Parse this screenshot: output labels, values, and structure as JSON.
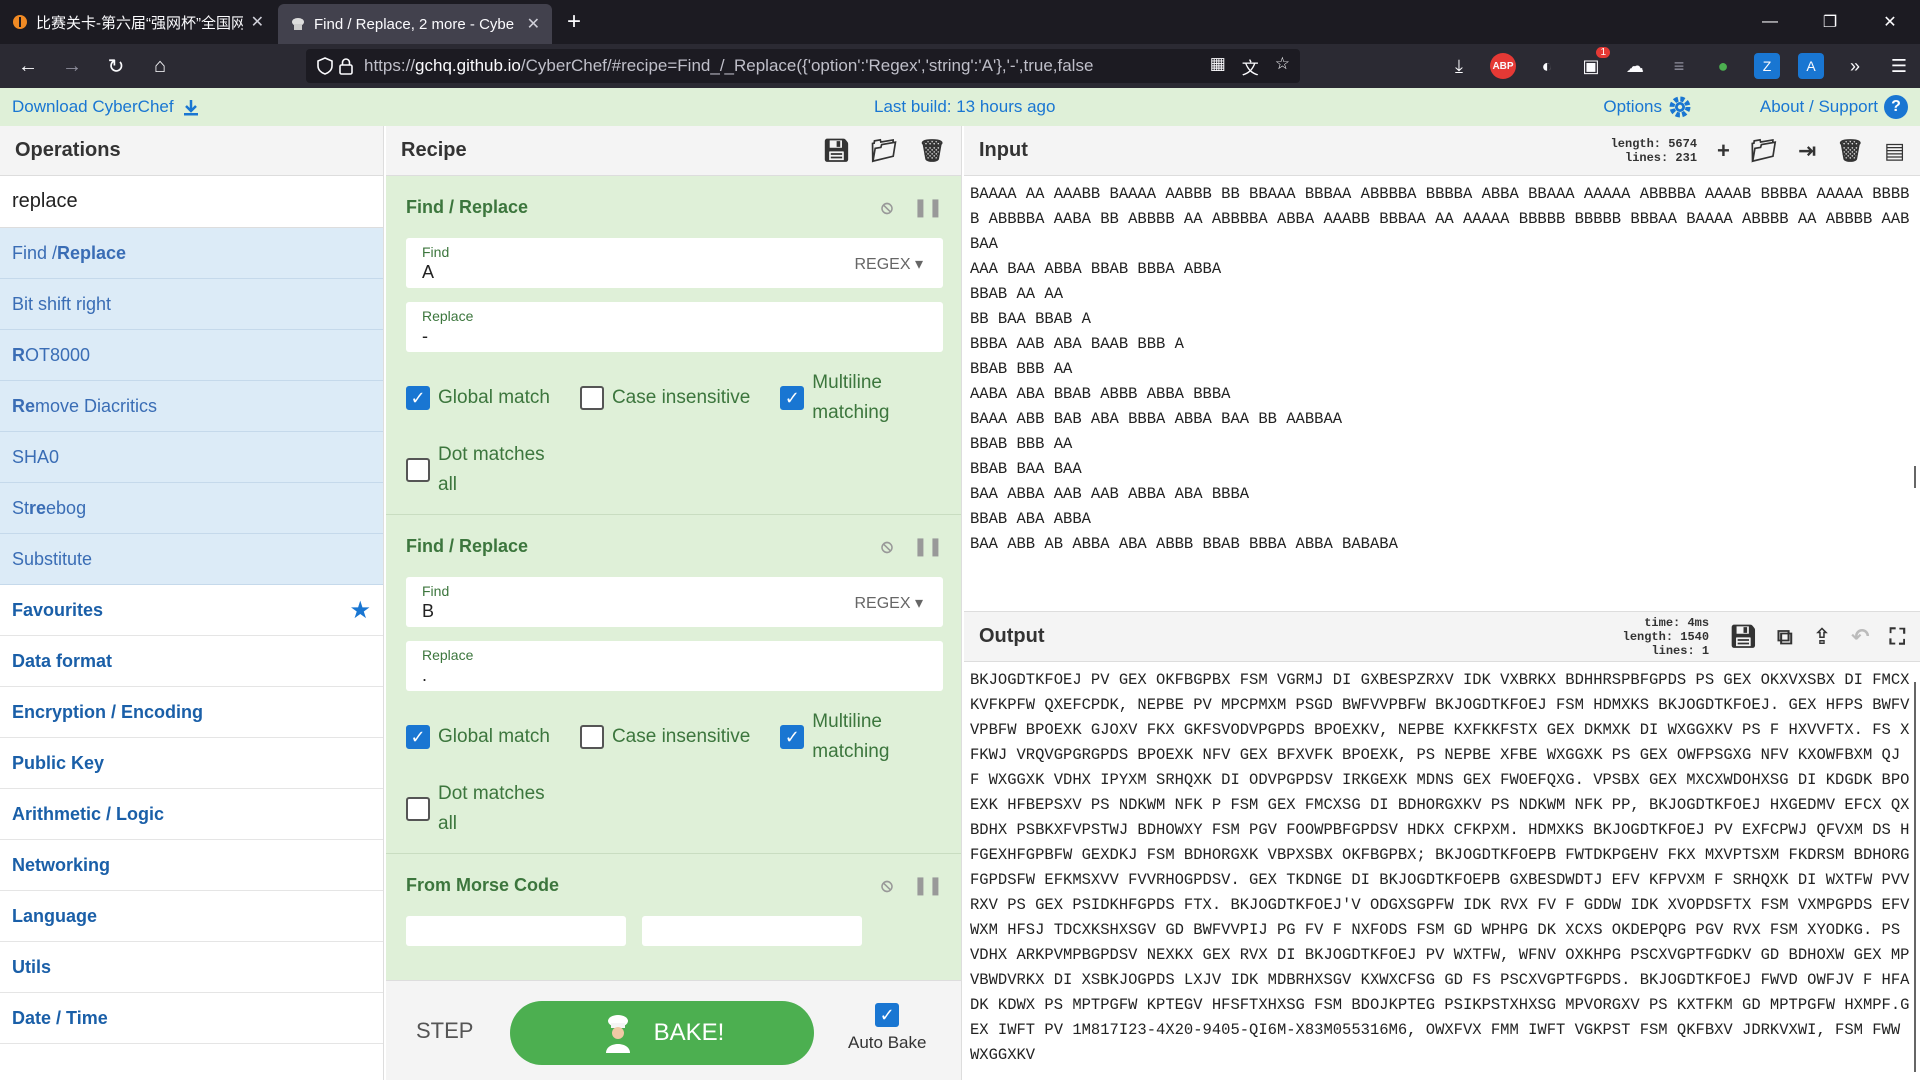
{
  "browser": {
    "tabs": [
      {
        "label": "比赛关卡-第六届“强网杯”全国网",
        "active": false
      },
      {
        "label": "Find / Replace, 2 more - Cybe",
        "active": true
      }
    ],
    "url_prefix": "https://",
    "url_host": "gchq.github.io",
    "url_path": "/CyberChef/#recipe=Find_/_Replace({'option':'Regex','string':'A'},'-',true,false",
    "extensions": [
      "download-icon",
      "adblock-icon",
      "extension-icon",
      "badge-extension-icon",
      "extension-icon-2",
      "extension-icon-3",
      "extension-icon-4",
      "zotero-icon",
      "translate-icon",
      "more-icon",
      "menu-icon"
    ],
    "ext_badge": "1",
    "abp_label": "ABP"
  },
  "banner": {
    "download": "Download CyberChef",
    "last_build": "Last build: 13 hours ago",
    "options": "Options",
    "about": "About / Support",
    "help": "?"
  },
  "operations": {
    "title": "Operations",
    "search": "replace",
    "results": [
      {
        "pre": "Find / ",
        "match": "Replace",
        "post": ""
      },
      {
        "pre": "Bit shift right",
        "match": "",
        "post": ""
      },
      {
        "pre": "",
        "match": "R",
        "post": "OT8000"
      },
      {
        "pre": "",
        "match": "Re",
        "post": "move Diacritics"
      },
      {
        "pre": "SHA0",
        "match": "",
        "post": ""
      },
      {
        "pre": "St",
        "match": "re",
        "post": "ebog"
      },
      {
        "pre": "Substitute",
        "match": "",
        "post": ""
      }
    ],
    "categories": [
      "Favourites",
      "Data format",
      "Encryption / Encoding",
      "Public Key",
      "Arithmetic / Logic",
      "Networking",
      "Language",
      "Utils",
      "Date / Time"
    ]
  },
  "recipe": {
    "title": "Recipe",
    "ops": [
      {
        "name": "Find / Replace",
        "find_label": "Find",
        "find": "A",
        "mode": "REGEX",
        "replace_label": "Replace",
        "replace": "-",
        "global": "Global match",
        "case": "Case insensitive",
        "multi1": "Multiline",
        "multi2": "matching",
        "dot1": "Dot matches",
        "dot2": "all"
      },
      {
        "name": "Find / Replace",
        "find_label": "Find",
        "find": "B",
        "mode": "REGEX",
        "replace_label": "Replace",
        "replace": ".",
        "global": "Global match",
        "case": "Case insensitive",
        "multi1": "Multiline",
        "multi2": "matching",
        "dot1": "Dot matches",
        "dot2": "all"
      },
      {
        "name": "From Morse Code"
      }
    ],
    "step": "STEP",
    "bake": "BAKE!",
    "auto_bake": "Auto Bake"
  },
  "input": {
    "title": "Input",
    "length_label": "length:",
    "length": "5674",
    "lines_label": "lines:",
    "lines": "231",
    "text": "BAAAA AA AAABB BAAAA AABBB BB BBAAA BBBAA ABBBBA BBBBA ABBA BBAAA AAAAA ABBBBA AAAAB BBBBA AAAAA BBBBB ABBBBA AABA BB ABBBB AA ABBBBA ABBA AAABB BBBAA AA AAAAA BBBBB BBBBB BBBAA BAAAA ABBBB AA ABBBB AABBAA\nAAA BAA ABBA BBAB BBBA ABBA\nBBAB AA AA\nBB BAA BBAB A\nBBBA AAB ABA BAAB BBB A\nBBAB BBB AA\nAABA ABA BBAB ABBB ABBA BBBA\nBAAA ABB BAB ABA BBBA ABBA BAA BB AABBAA\nBBAB BBB AA\nBBAB BAA BAA\nBAA ABBA AAB AAB ABBA ABA BBBA\nBBAB ABA ABBA\nBAA ABB AB ABBA ABA ABBB BBAB BBBA ABBA BABABA"
  },
  "output": {
    "title": "Output",
    "time_label": "time:",
    "time": "4ms",
    "length_label": "length:",
    "length": "1540",
    "lines_label": "lines:",
    "lines": "1",
    "text": "BKJOGDTKFOEJ PV GEX OKFBGPBX FSM VGRMJ DI GXBESPZRXV IDK VXBRKX BDHHRSPBFGPDS PS GEX OKXVXSBX DI FMCXKVFKPFW QXEFCPDK, NEPBE PV MPCPMXM PSGD BWFVVPBFW BKJOGDTKFOEJ FSM HDMXKS BKJOGDTKFOEJ. GEX HFPS BWFVVPBFW BPOEXK GJOXV FKX GKFSVODVPGPDS BPOEXKV, NEPBE KXFKKFSTX GEX DKMXK DI WXGGXKV PS F HXVVFTX. FS XFKWJ VRQVGPGRGPDS BPOEXK NFV GEX BFXVFK BPOEXK, PS NEPBE XFBE WXGGXK PS GEX OWFPSGXG NFV KXOWFBXM QJ F WXGGXK VDHX IPYXM SRHQXK DI ODVPGPDSV IRKGEXK MDNS GEX FWOEFQXG. VPSBX GEX MXCXWDOHXSG DI KDGDK BPOEXK HFBEPSXV PS NDKWM NFK P FSM GEX FMCXSG DI BDHORGXKV PS NDKWM NFK PP, BKJOGDTKFOEJ HXGEDMV EFCX QXBDHX PSBKXFVPSTWJ BDHOWXY FSM PGV FOOWPBFGPDSV HDKX CFKPXM. HDMXKS BKJOGDTKFOEJ PV EXFCPWJ QFVXM DS HFGEXHFGPBFW GEXDKJ FSM BDHORGXK VBPXSBX OKFBGPBX; BKJOGDTKFOEPB FWTDKPGEHV FKX MXVPTSXM FKDRSM BDHORGFGPDSFW EFKMSXVV FVVRHOGPDSV. GEX TKDNGE DI BKJOGDTKFOEPB GXBESDWDTJ EFV KFPVXM F SRHQXK DI WXTFW PVVRXV PS GEX PSIDKHFGPDS FTX. BKJOGDTKFOEJ'V ODGXSGPFW IDK RVX FV F GDDW IDK XVOPDSFTX FSM VXMPGPDS EFV WXM HFSJ TDCXKSHXSGV GD BWFVVPIJ PG FV F NXFODS FSM GD WPHPG DK XCXS OKDEPQPG PGV RVX FSM XYODKG. PS VDHX ARKPVMPBGPDSV NEXKX GEX RVX DI BKJOGDTKFOEJ PV WXTFW, WFNV OXKHPG PSCXVGPTFGDKV GD BDHOXW GEX MPVBWDVRKX DI XSBKJOGPDS LXJV IDK MDBRHXSGV KXWXCFSG GD FS PSCXVGPTFGPDS. BKJOGDTKFOEJ FWVD OWFJV F HFADK KDWX PS MPTPGFW KPTEGV HFSFTXHXSG FSM BDOJKPTEG PSIKPSTXHXSG MPVORGXV PS KXTFKM GD MPTPGFW HXMPF.GEX IWFT PV 1M817I23-4X20-9405-QI6M-X83M055316M6, OWXFVX FMM IWFT VGKPST FSM QKFBXV JDRKVXWI, FSM FWW WXGGXKV"
  },
  "colors": {
    "chrome_dark": "#1c1b22",
    "chrome_nav": "#2b2a33",
    "banner_bg": "#dff0d8",
    "link_blue": "#1976d2",
    "recipe_green": "#3c763d",
    "bake_green": "#4caf50",
    "op_bg": "#dcebf7"
  }
}
